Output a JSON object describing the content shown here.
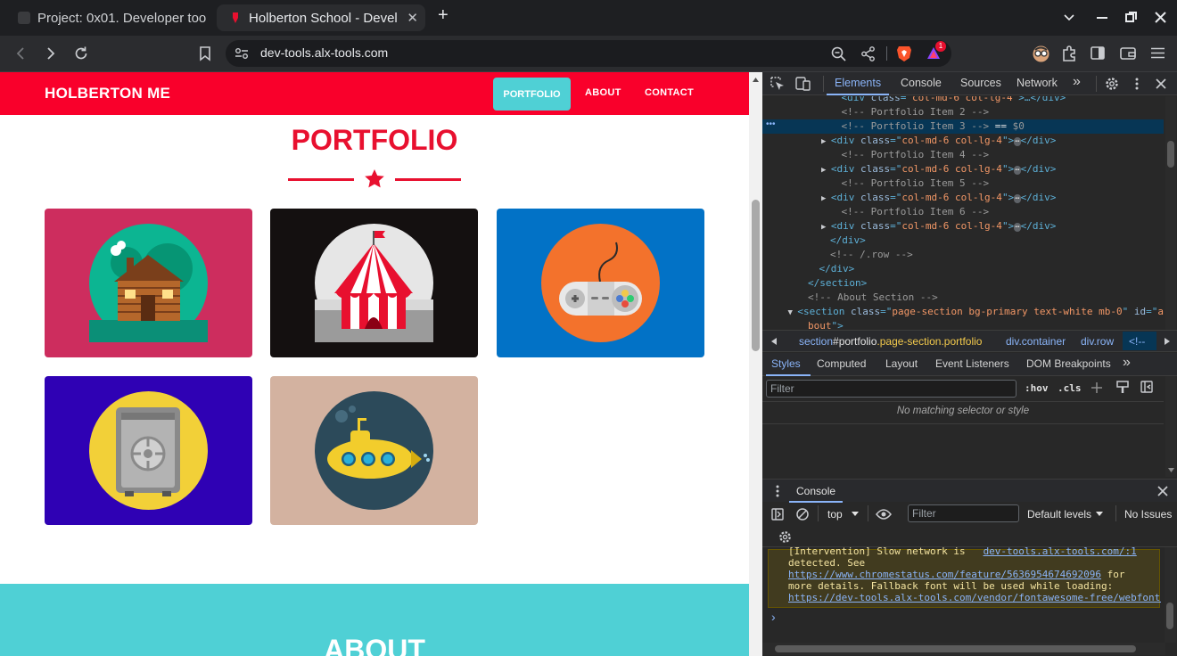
{
  "browser": {
    "tabs": [
      {
        "title": "Project: 0x01. Developer too",
        "active": false
      },
      {
        "title": "Holberton School - Devel",
        "active": true
      }
    ],
    "new_tab_glyph": "+",
    "url": "dev-tools.alx-tools.com",
    "brave_badge": "1",
    "icons": [
      "back-icon",
      "forward-icon",
      "reload-icon",
      "bookmark-icon",
      "site-info-icon",
      "zoom-icon",
      "share-icon",
      "brave-shield-icon",
      "brave-rewards-icon",
      "extension-avatar-icon",
      "extensions-icon",
      "sidebar-icon",
      "wallet-icon",
      "menu-icon"
    ]
  },
  "site": {
    "brand": "HOLBERTON ME",
    "nav": {
      "portfolio": "PORTFOLIO",
      "about": "ABOUT",
      "contact": "CONTACT"
    },
    "section_title": "PORTFOLIO",
    "next_section_title": "ABOUT",
    "colors": {
      "primary": "#f9002b",
      "accent": "#4fd0d5"
    },
    "portfolio_items": [
      {
        "icon": "cabin-icon",
        "bg": "#cd2d5e"
      },
      {
        "icon": "circus-tent-icon",
        "bg": "#141010"
      },
      {
        "icon": "game-controller-icon",
        "bg": "#0272c6"
      },
      {
        "icon": "safe-icon",
        "bg": "#2f01b4"
      },
      {
        "icon": "submarine-icon",
        "bg": "#d3b2a0"
      }
    ]
  },
  "devtools": {
    "tabs": [
      "Elements",
      "Console",
      "Sources",
      "Network"
    ],
    "active_tab": "Elements",
    "more_glyph": "»",
    "elements_lines": [
      {
        "indent": 5,
        "parts": [
          [
            "c-tag",
            "<div "
          ],
          [
            "c-attr",
            "class"
          ],
          [
            "c-tag",
            "=\""
          ],
          [
            "c-val",
            "col-md-6 col-lg-4"
          ],
          [
            "c-tag",
            "\">…</div>"
          ]
        ]
      },
      {
        "indent": 5,
        "parts": [
          [
            "c-cmt",
            "<!-- Portfolio Item 2 -->"
          ]
        ]
      },
      {
        "indent": 5,
        "selected": true,
        "parts": [
          [
            "c-cmt",
            "<!-- Portfolio Item 3 -->"
          ],
          [
            "c-txt",
            " == "
          ],
          [
            "c-cmt",
            "$0"
          ]
        ]
      },
      {
        "indent": 4,
        "arrow": "▶",
        "parts": [
          [
            "c-tag",
            "<div "
          ],
          [
            "c-attr",
            "class"
          ],
          [
            "c-tag",
            "=\""
          ],
          [
            "c-val",
            "col-md-6 col-lg-4"
          ],
          [
            "c-tag",
            "\">"
          ],
          [
            "c-txt",
            "⋯"
          ],
          [
            "c-tag",
            "</div>"
          ]
        ]
      },
      {
        "indent": 5,
        "parts": [
          [
            "c-cmt",
            "<!-- Portfolio Item 4 -->"
          ]
        ]
      },
      {
        "indent": 4,
        "arrow": "▶",
        "parts": [
          [
            "c-tag",
            "<div "
          ],
          [
            "c-attr",
            "class"
          ],
          [
            "c-tag",
            "=\""
          ],
          [
            "c-val",
            "col-md-6 col-lg-4"
          ],
          [
            "c-tag",
            "\">"
          ],
          [
            "c-txt",
            "⋯"
          ],
          [
            "c-tag",
            "</div>"
          ]
        ]
      },
      {
        "indent": 5,
        "parts": [
          [
            "c-cmt",
            "<!-- Portfolio Item 5 -->"
          ]
        ]
      },
      {
        "indent": 4,
        "arrow": "▶",
        "parts": [
          [
            "c-tag",
            "<div "
          ],
          [
            "c-attr",
            "class"
          ],
          [
            "c-tag",
            "=\""
          ],
          [
            "c-val",
            "col-md-6 col-lg-4"
          ],
          [
            "c-tag",
            "\">"
          ],
          [
            "c-txt",
            "⋯"
          ],
          [
            "c-tag",
            "</div>"
          ]
        ]
      },
      {
        "indent": 5,
        "parts": [
          [
            "c-cmt",
            "<!-- Portfolio Item 6 -->"
          ]
        ]
      },
      {
        "indent": 4,
        "arrow": "▶",
        "parts": [
          [
            "c-tag",
            "<div "
          ],
          [
            "c-attr",
            "class"
          ],
          [
            "c-tag",
            "=\""
          ],
          [
            "c-val",
            "col-md-6 col-lg-4"
          ],
          [
            "c-tag",
            "\">"
          ],
          [
            "c-txt",
            "⋯"
          ],
          [
            "c-tag",
            "</div>"
          ]
        ]
      },
      {
        "indent": 4,
        "parts": [
          [
            "c-tag",
            "</div>"
          ]
        ]
      },
      {
        "indent": 4,
        "parts": [
          [
            "c-cmt",
            "<!-- /.row -->"
          ]
        ]
      },
      {
        "indent": 3,
        "parts": [
          [
            "c-tag",
            "</div>"
          ]
        ]
      },
      {
        "indent": 2,
        "parts": [
          [
            "c-tag",
            "</section>"
          ]
        ]
      },
      {
        "indent": 2,
        "parts": [
          [
            "c-cmt",
            "<!-- About Section -->"
          ]
        ]
      },
      {
        "indent": 1,
        "arrow": "▼",
        "parts": [
          [
            "c-tag",
            "<section "
          ],
          [
            "c-attr",
            "class"
          ],
          [
            "c-tag",
            "=\""
          ],
          [
            "c-val",
            "page-section bg-primary text-white mb-0"
          ],
          [
            "c-tag",
            "\" "
          ],
          [
            "c-attr",
            "id"
          ],
          [
            "c-tag",
            "=\""
          ],
          [
            "c-val",
            "a"
          ]
        ]
      },
      {
        "indent": 2,
        "parts": [
          [
            "c-val",
            "bout"
          ],
          [
            "c-tag",
            "\">"
          ]
        ]
      }
    ],
    "breadcrumb": [
      "section#portfolio.page-section.portfolio",
      "div.container",
      "div.row",
      "<!--"
    ],
    "styles_tabs": [
      "Styles",
      "Computed",
      "Layout",
      "Event Listeners",
      "DOM Breakpoints"
    ],
    "filter_placeholder": "Filter",
    "hov": ":hov",
    "cls": ".cls",
    "no_match": "No matching selector or style",
    "console": {
      "title": "Console",
      "context": "top",
      "filter_placeholder": "Filter",
      "levels": "Default levels",
      "issues": "No Issues",
      "message_lines": [
        "[Intervention] Slow network is ",
        "detected. See",
        " for",
        "more details. Fallback font will be used while loading:"
      ],
      "message_source": "dev-tools.alx-tools.com/:1",
      "link1": "https://www.chromestatus.com/feature/5636954674692096",
      "link2": "https://dev-tools.alx-tools.com/vendor/fontawesome-free/webfonts",
      "prompt": "›"
    }
  }
}
